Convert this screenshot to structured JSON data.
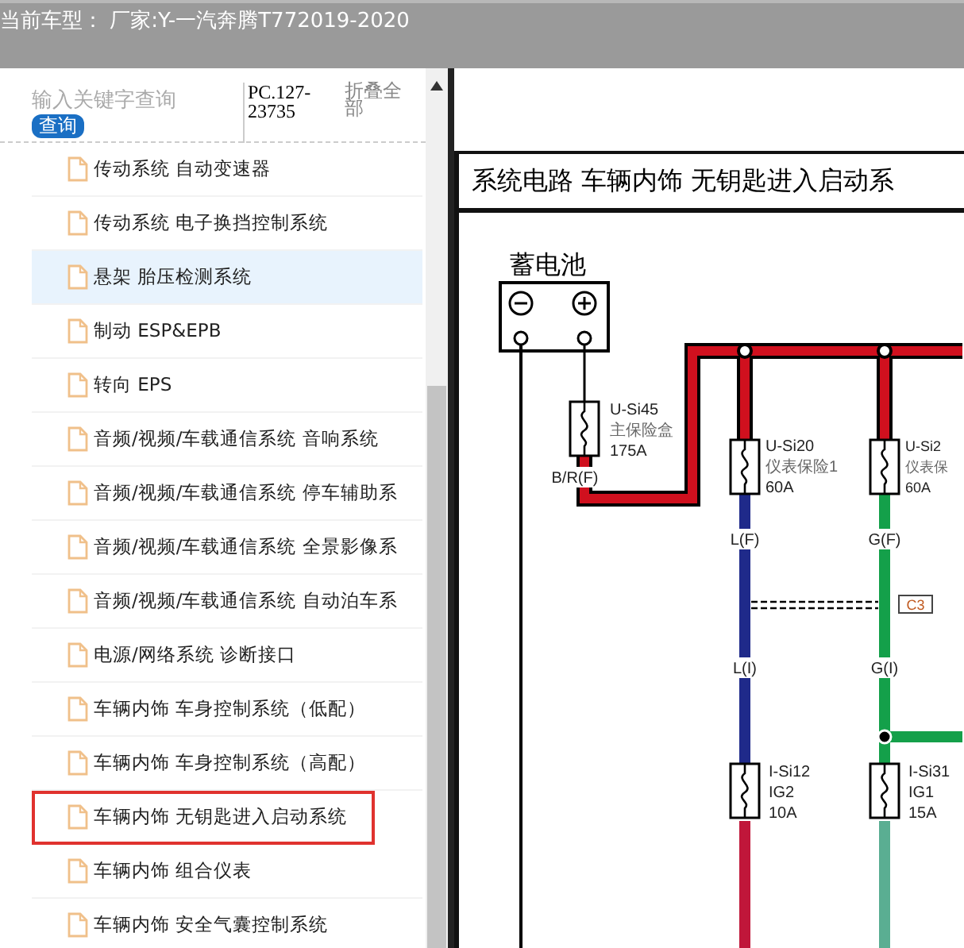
{
  "header": {
    "title": "当前车型： 厂家:Y-一汽奔腾T772019-2020"
  },
  "search": {
    "placeholder": "输入关键字查询",
    "button": "查询",
    "code": "PC.127-23735",
    "collapse": "折叠全部"
  },
  "sidebar": {
    "items": [
      {
        "label": "传动系统 自动变速器",
        "selected": false,
        "outlined": false
      },
      {
        "label": "传动系统 电子换挡控制系统",
        "selected": false,
        "outlined": false
      },
      {
        "label": "悬架 胎压检测系统",
        "selected": true,
        "outlined": false
      },
      {
        "label": "制动 ESP&EPB",
        "selected": false,
        "outlined": false
      },
      {
        "label": "转向 EPS",
        "selected": false,
        "outlined": false
      },
      {
        "label": "音频/视频/车载通信系统 音响系统",
        "selected": false,
        "outlined": false
      },
      {
        "label": "音频/视频/车载通信系统 停车辅助系",
        "selected": false,
        "outlined": false
      },
      {
        "label": "音频/视频/车载通信系统 全景影像系",
        "selected": false,
        "outlined": false
      },
      {
        "label": "音频/视频/车载通信系统 自动泊车系",
        "selected": false,
        "outlined": false
      },
      {
        "label": "电源/网络系统 诊断接口",
        "selected": false,
        "outlined": false
      },
      {
        "label": "车辆内饰 车身控制系统（低配）",
        "selected": false,
        "outlined": false
      },
      {
        "label": "车辆内饰 车身控制系统（高配）",
        "selected": false,
        "outlined": false
      },
      {
        "label": "车辆内饰 无钥匙进入启动系统",
        "selected": false,
        "outlined": true
      },
      {
        "label": "车辆内饰 组合仪表",
        "selected": false,
        "outlined": false
      },
      {
        "label": "车辆内饰 安全气囊控制系统",
        "selected": false,
        "outlined": false
      }
    ]
  },
  "diagram": {
    "title": "系统电路 车辆内饰 无钥匙进入启动系",
    "battery_label": "蓄电池",
    "fuses": [
      {
        "lines": [
          "U-Si45",
          "主保险盒",
          "175A"
        ]
      },
      {
        "lines": [
          "U-Si20",
          "仪表保险1",
          "60A"
        ]
      },
      {
        "lines": [
          "U-Si2",
          "仪表保",
          "60A"
        ]
      },
      {
        "lines": [
          "I-Si12",
          "IG2",
          "10A"
        ]
      },
      {
        "lines": [
          "I-Si31",
          "IG1",
          "15A"
        ]
      }
    ],
    "wire_labels": [
      "B/R(F)",
      "L(F)",
      "G(F)",
      "L(I)",
      "G(I)"
    ],
    "connector": "C3"
  }
}
